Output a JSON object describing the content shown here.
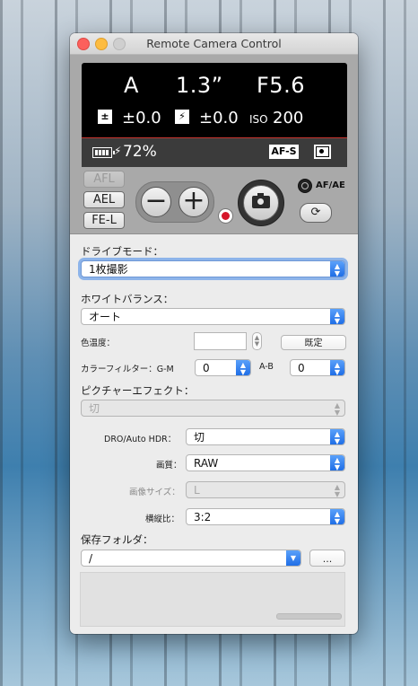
{
  "window": {
    "title": "Remote Camera Control"
  },
  "lcd": {
    "mode": "A",
    "shutter_speed": "1.3”",
    "aperture": "F5.6",
    "exposure_comp_icon": "±",
    "exposure_comp": "±0.0",
    "flash_comp_icon": "⚡",
    "flash_comp": "±0.0",
    "iso_label": "ISO",
    "iso_value": "200",
    "battery_percent": "72%",
    "battery_level": 0.72,
    "focus_mode": "AF-S",
    "metering_icon": "multi-metering-icon"
  },
  "controls": {
    "afl": "AFL",
    "ael": "AEL",
    "fel": "FE-L",
    "zoom_out": "−",
    "zoom_in": "+",
    "afae_label": "AF/AE",
    "afae_icon": "⟳"
  },
  "settings": {
    "drive_mode_label": "ドライブモード：",
    "drive_mode_value": "1枚撮影",
    "white_balance_label": "ホワイトバランス：",
    "white_balance_value": "オート",
    "color_temp_label": "色温度：",
    "color_temp_value": "",
    "default_button": "既定",
    "color_filter_label": "カラーフィルター：G-M",
    "color_filter_gm_value": "0",
    "ab_label": "A-B",
    "color_filter_ab_value": "0",
    "picture_effect_label": "ピクチャーエフェクト：",
    "picture_effect_value": "切",
    "dro_label": "DRO/Auto HDR：",
    "dro_value": "切",
    "quality_label": "画質：",
    "quality_value": "RAW",
    "image_size_label": "画像サイズ：",
    "image_size_value": "L",
    "aspect_label": "横縦比：",
    "aspect_value": "3:2",
    "save_folder_label": "保存フォルダ：",
    "save_folder_value": "/",
    "browse_button": "..."
  },
  "colors": {
    "accent": "#1f6ee6",
    "record": "#d6162a",
    "lcd_bg": "#000000"
  }
}
